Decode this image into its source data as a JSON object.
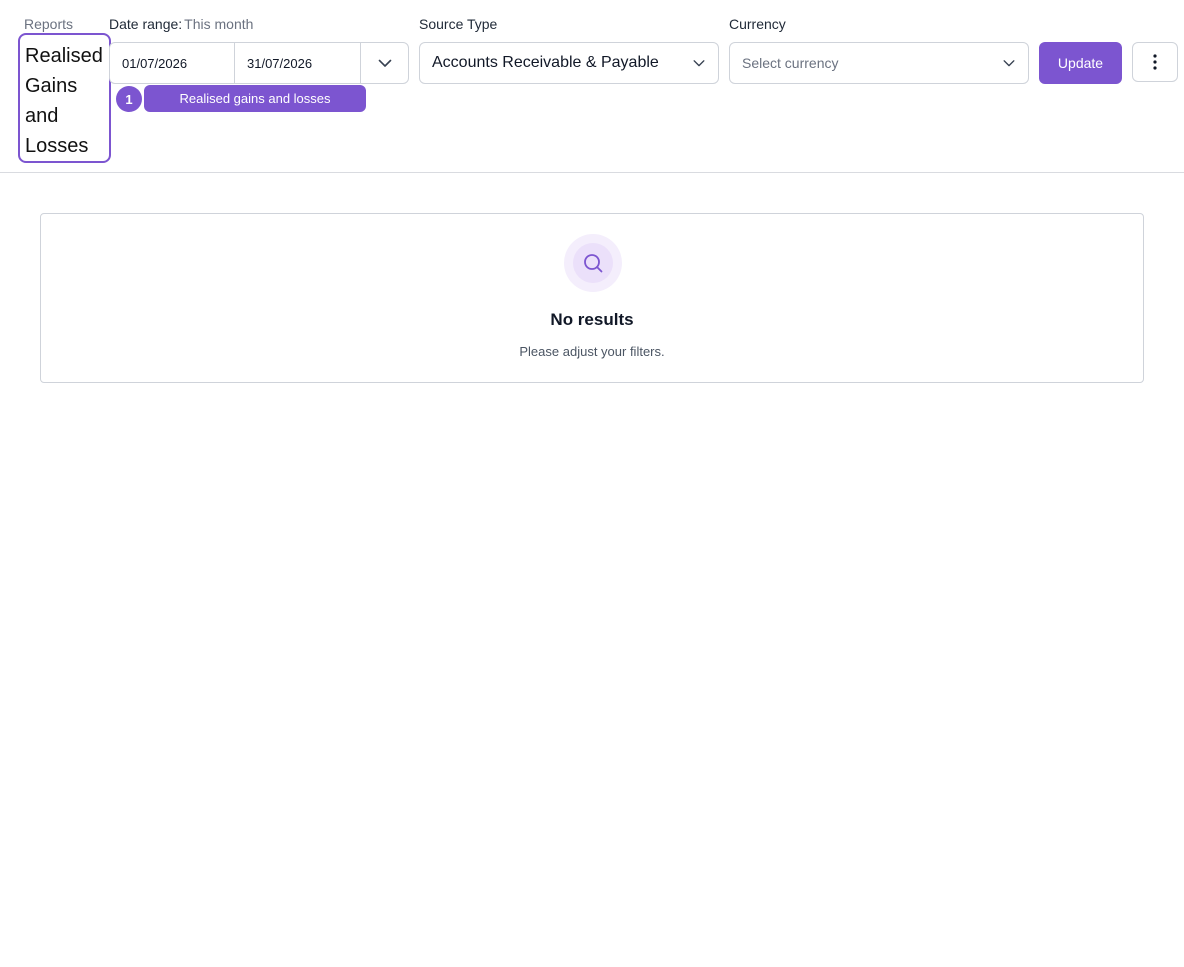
{
  "breadcrumb": "Reports",
  "page_title": "Realised Gains and Losses",
  "filters": {
    "date_range": {
      "label": "Date range:",
      "preset": "This month",
      "start": "01/07/2026",
      "end": "31/07/2026"
    },
    "source_type": {
      "label": "Source Type",
      "value": "Accounts Receivable & Payable"
    },
    "currency": {
      "label": "Currency",
      "placeholder": "Select currency"
    },
    "update_label": "Update"
  },
  "step": {
    "number": "1",
    "label": "Realised gains and losses"
  },
  "results": {
    "title": "No results",
    "message": "Please adjust your filters."
  },
  "colors": {
    "accent": "#7c55d0",
    "border": "#cfd3da",
    "muted_text": "#6b7280"
  },
  "icons": {
    "date_toggle": "chevron-down-icon",
    "select_toggle": "chevron-down-icon",
    "more": "more-vertical-icon",
    "empty_state": "search-icon"
  }
}
